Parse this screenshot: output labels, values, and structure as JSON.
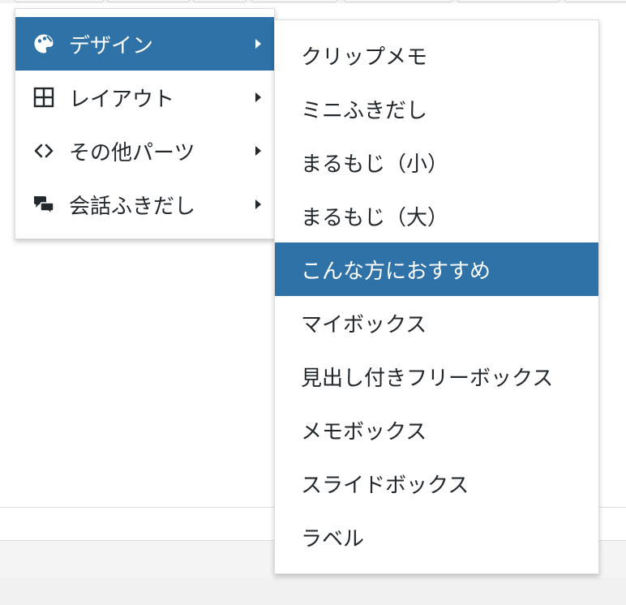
{
  "main_menu": {
    "items": [
      {
        "label": "デザイン",
        "icon": "palette-icon",
        "active": true
      },
      {
        "label": "レイアウト",
        "icon": "grid-icon",
        "active": false
      },
      {
        "label": "その他パーツ",
        "icon": "code-icon",
        "active": false
      },
      {
        "label": "会話ふきだし",
        "icon": "speech-bubbles-icon",
        "active": false
      }
    ]
  },
  "sub_menu": {
    "items": [
      {
        "label": "クリップメモ"
      },
      {
        "label": "ミニふきだし"
      },
      {
        "label": "まるもじ（小）"
      },
      {
        "label": "まるもじ（大）"
      },
      {
        "label": "こんな方におすすめ",
        "active": true
      },
      {
        "label": "マイボックス"
      },
      {
        "label": "見出し付きフリーボックス"
      },
      {
        "label": "メモボックス"
      },
      {
        "label": "スライドボックス"
      },
      {
        "label": "ラベル"
      }
    ]
  },
  "colors": {
    "highlight": "#2e72a8",
    "text": "#23282d",
    "menu_background": "#ffffff"
  }
}
